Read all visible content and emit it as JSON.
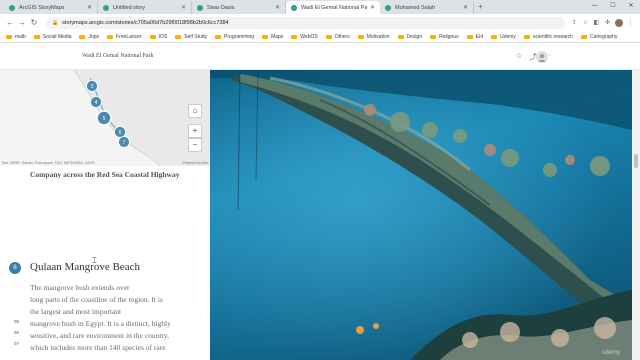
{
  "browser": {
    "tabs": [
      {
        "title": "ArcGIS StoryMaps",
        "active": false
      },
      {
        "title": "Untitled story",
        "active": false
      },
      {
        "title": "Siwa Oasis",
        "active": false
      },
      {
        "title": "Wadi El Gemal National Park",
        "active": true
      },
      {
        "title": "Mohamed Salah",
        "active": false
      }
    ],
    "new_tab": "+",
    "url": "storymaps.arcgis.com/stories/c705a00d7b29f0018f98b2b0c6cc7384",
    "bookmarks": [
      "maib",
      "Social Media",
      "Jops",
      "FreeLancer",
      "IOS",
      "Self Study",
      "Programming",
      "Maps",
      "WebOS",
      "Others",
      "Motivation",
      "Design",
      "Religous",
      "Ent",
      "Udemy",
      "scientific research",
      "Cartography"
    ]
  },
  "story": {
    "title": "Wadi El Gemal National Park",
    "map_markers": [
      "3",
      "4",
      "5",
      "6",
      "7"
    ],
    "map_attribution": "Esri, HERE, Garmin, Foursquare, FAO, METI/NASA, USGS",
    "map_powered": "Powered by Esri",
    "prev_caption": "Company across the Red Sea Coastal Highway",
    "section_number": "6",
    "section_title": "Qulaan Mangrove Beach",
    "body_lines": [
      "The mangrove bush extends over",
      "long parts of the coastline of the region. It is",
      "the largest and most important",
      "mangrove bush in Egypt. It is a distinct, highly",
      "sensitive, and rare environment in the country,",
      "which includes more than 140 species of rare"
    ],
    "side_numbers": [
      "05",
      "06",
      "07"
    ],
    "watermark": "udemy"
  },
  "colors": {
    "accent": "#3d7fa6",
    "marker": "#4a8bb0",
    "sea": "#1f7fa8"
  }
}
